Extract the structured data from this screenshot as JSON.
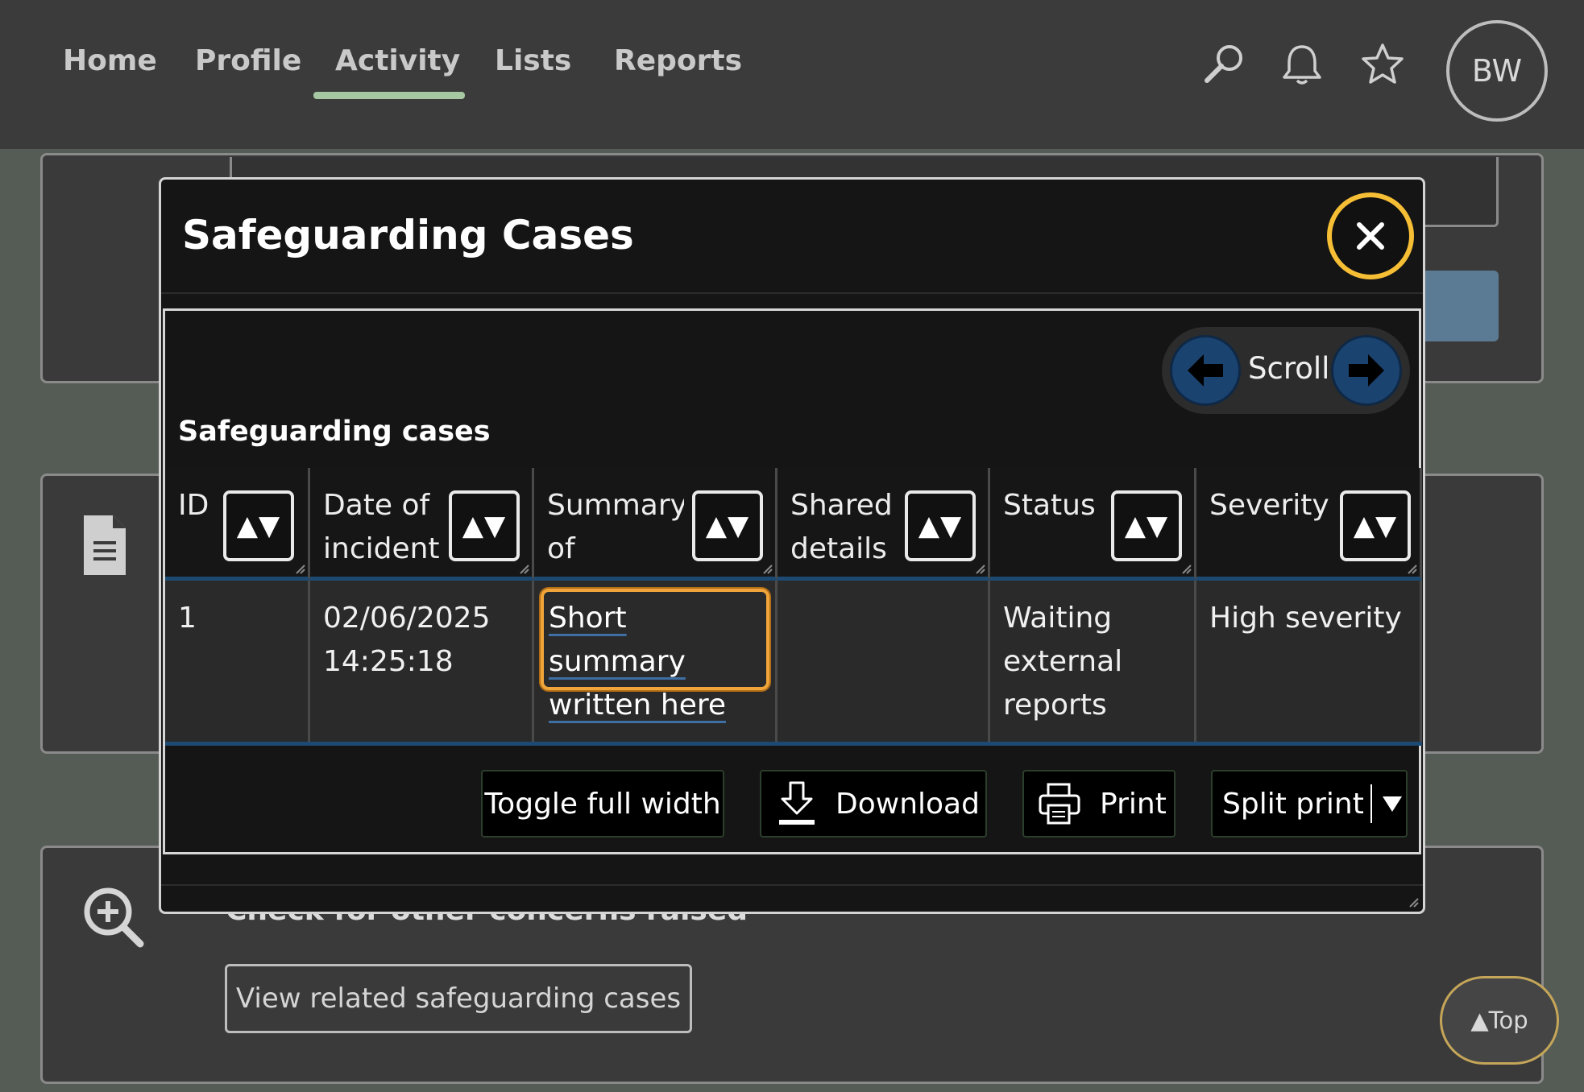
{
  "nav": {
    "items": [
      {
        "label": "Home"
      },
      {
        "label": "Profile"
      },
      {
        "label": "Activity",
        "active": true
      },
      {
        "label": "Lists"
      },
      {
        "label": "Reports"
      }
    ],
    "icons": [
      "search-icon",
      "bell-icon",
      "star-icon"
    ],
    "avatar_initials": "BW"
  },
  "background": {
    "hidden_heading": "Check for other concerns raised",
    "related_button": "View related safeguarding cases",
    "top_button": "▲Top"
  },
  "modal": {
    "title": "Safeguarding Cases",
    "scroll_label": "Scroll",
    "table_caption": "Safeguarding cases",
    "columns": [
      {
        "label": "ID"
      },
      {
        "label": "Date of incident"
      },
      {
        "label": "Summary of"
      },
      {
        "label": "Shared details"
      },
      {
        "label": "Status"
      },
      {
        "label": "Severity"
      }
    ],
    "sort_glyph": "▲▼",
    "rows": [
      {
        "id": "1",
        "date": "02/06/2025 14:25:18",
        "summary": "Short summary written here",
        "shared": "",
        "status": "Waiting external reports",
        "severity": "High severity"
      }
    ],
    "actions": {
      "toggle": "Toggle full width",
      "download": "Download",
      "print": "Print",
      "split_print": "Split print"
    }
  },
  "colors": {
    "accent_close": "#f6be35",
    "focus_orange": "#f0a53a",
    "scroll_blue": "#1b4370",
    "nav_active": "#a5c7a1"
  }
}
